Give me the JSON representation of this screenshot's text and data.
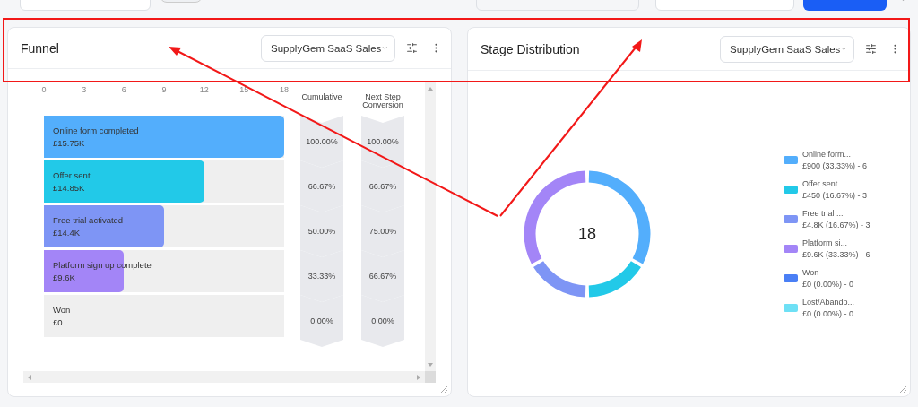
{
  "funnel": {
    "title": "Funnel",
    "source": "SupplyGem SaaS Sales",
    "columns": [
      "Cumulative",
      "Next Step Conversion"
    ],
    "stages": [
      {
        "amount": "£15.75K",
        "cumulative": "100.00%",
        "next_step": "100.00%",
        "color": "#53aefc"
      },
      {
        "amount": "£14.85K",
        "cumulative": "66.67%",
        "next_step": "66.67%",
        "color": "#22c9e8"
      },
      {
        "amount": "£14.4K",
        "cumulative": "50.00%",
        "next_step": "75.00%",
        "color": "#7e95f5"
      },
      {
        "amount": "£9.6K",
        "cumulative": "33.33%",
        "next_step": "66.67%",
        "color": "#a385f7"
      },
      {
        "amount": "£0",
        "cumulative": "0.00%",
        "next_step": "0.00%"
      }
    ],
    "chart_data": {
      "type": "bar",
      "orientation": "horizontal",
      "categories": [
        "Online form completed",
        "Offer sent",
        "Free trial activated",
        "Platform sign up complete",
        "Won"
      ],
      "values": [
        18,
        12,
        9,
        6,
        0
      ],
      "xlim": [
        0,
        18
      ],
      "xticks": [
        0,
        3,
        6,
        9,
        12,
        15,
        18
      ]
    }
  },
  "distribution": {
    "title": "Stage Distribution",
    "source": "SupplyGem SaaS Sales",
    "total": "18",
    "legend": [
      {
        "detail": "£900 (33.33%) - 6",
        "color": "#53aefc"
      },
      {
        "detail": "£450 (16.67%) - 3",
        "color": "#22c9e8"
      },
      {
        "detail": "£4.8K (16.67%) - 3",
        "color": "#7e95f5"
      },
      {
        "detail": "£9.6K (33.33%) - 6",
        "color": "#a385f7"
      },
      {
        "detail": "£0 (0.00%) - 0",
        "color": "#4a7ff5"
      },
      {
        "detail": "£0 (0.00%) - 0",
        "color": "#6ee0f5"
      }
    ],
    "chart_data": {
      "type": "donut",
      "categories": [
        "Online form...",
        "Offer sent",
        "Free trial ...",
        "Platform si...",
        "Won",
        "Lost/Abando..."
      ],
      "values": [
        33.33,
        16.67,
        16.67,
        33.33,
        0,
        0
      ]
    }
  }
}
